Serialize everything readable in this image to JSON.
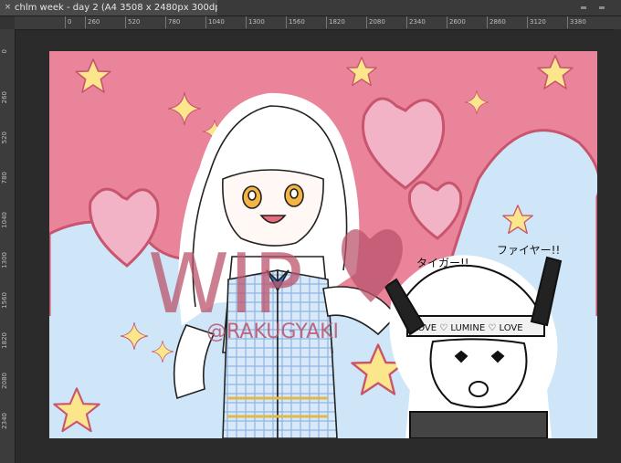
{
  "window": {
    "tab_title": "chlm week - day 2 (A4 3508 x 2480px 300dpi 40.7%)",
    "close_glyph": "×"
  },
  "ruler": {
    "horizontal": [
      "0",
      "260",
      "520",
      "780",
      "1040",
      "1300",
      "1560",
      "1820",
      "2080",
      "2340",
      "2600",
      "2860",
      "3120",
      "3380"
    ],
    "vertical": [
      "0",
      "260",
      "520",
      "780",
      "1040",
      "1300",
      "1560",
      "1820",
      "2080",
      "2340"
    ]
  },
  "artwork": {
    "watermark_main": "WIP",
    "watermark_handle": "@RAKUGYAKI",
    "headband_text": "LOVE ♡ LUMINE ♡ LOVE",
    "shout_left": "タイガー!!",
    "shout_right": "ファイヤー!!",
    "colors": {
      "pink_bg": "#e9849a",
      "blue_bg": "#cfe6f8",
      "star": "#fbe68c",
      "heart": "#f2b3c6",
      "watermark": "#b9546c"
    }
  }
}
